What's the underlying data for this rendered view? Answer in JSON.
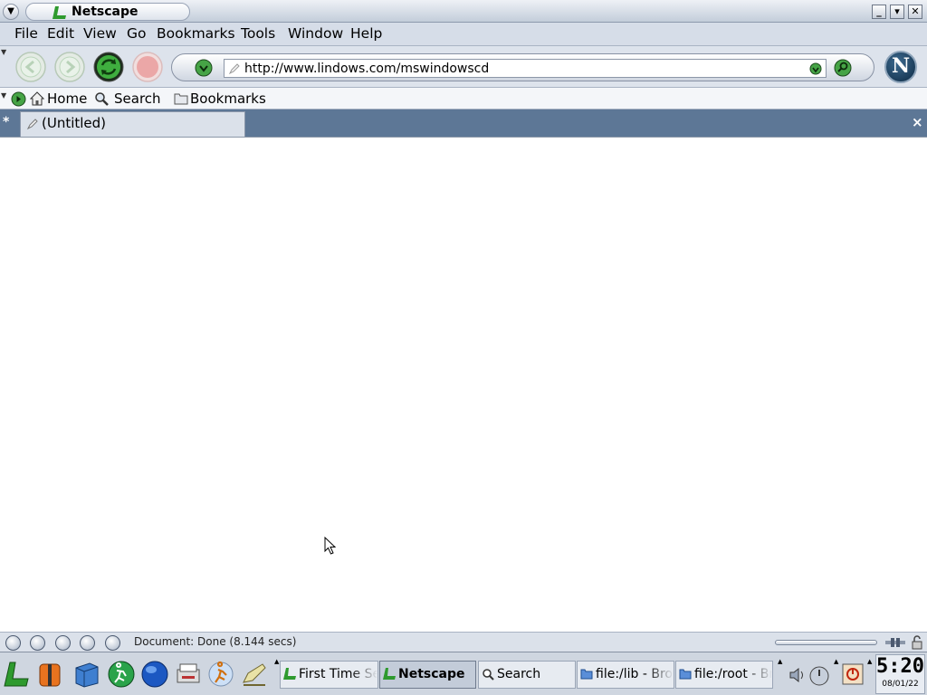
{
  "window": {
    "title": "Netscape"
  },
  "menubar": {
    "items": [
      {
        "label": "File"
      },
      {
        "label": "Edit"
      },
      {
        "label": "View"
      },
      {
        "label": "Go"
      },
      {
        "label": "Bookmarks"
      },
      {
        "label": "Tools"
      },
      {
        "label": "Window"
      },
      {
        "label": "Help"
      }
    ]
  },
  "navbar": {
    "url": "http://www.lindows.com/mswindowscd",
    "logo_letter": "N"
  },
  "personal_toolbar": {
    "home_label": "Home",
    "search_label": "Search",
    "bookmarks_label": "Bookmarks"
  },
  "tabs": {
    "active_label": "(Untitled)",
    "new_tab_glyph": "*",
    "close_glyph": "×"
  },
  "statusbar": {
    "text": "Document: Done (8.144 secs)"
  },
  "taskbar": {
    "tasks": [
      {
        "label": "First Time Setup",
        "active": false
      },
      {
        "label": "Netscape",
        "active": true
      },
      {
        "label": "Search",
        "active": false
      },
      {
        "label": "file:/lib - Browser",
        "active": false
      },
      {
        "label": "file:/root - Browser",
        "active": false
      }
    ],
    "clock_time": "5:20",
    "clock_date": "08/01/22"
  },
  "colors": {
    "tab_strip": "#5d7796",
    "accent_green": "#2e9a2e",
    "stop_red": "#e8a0a0"
  }
}
